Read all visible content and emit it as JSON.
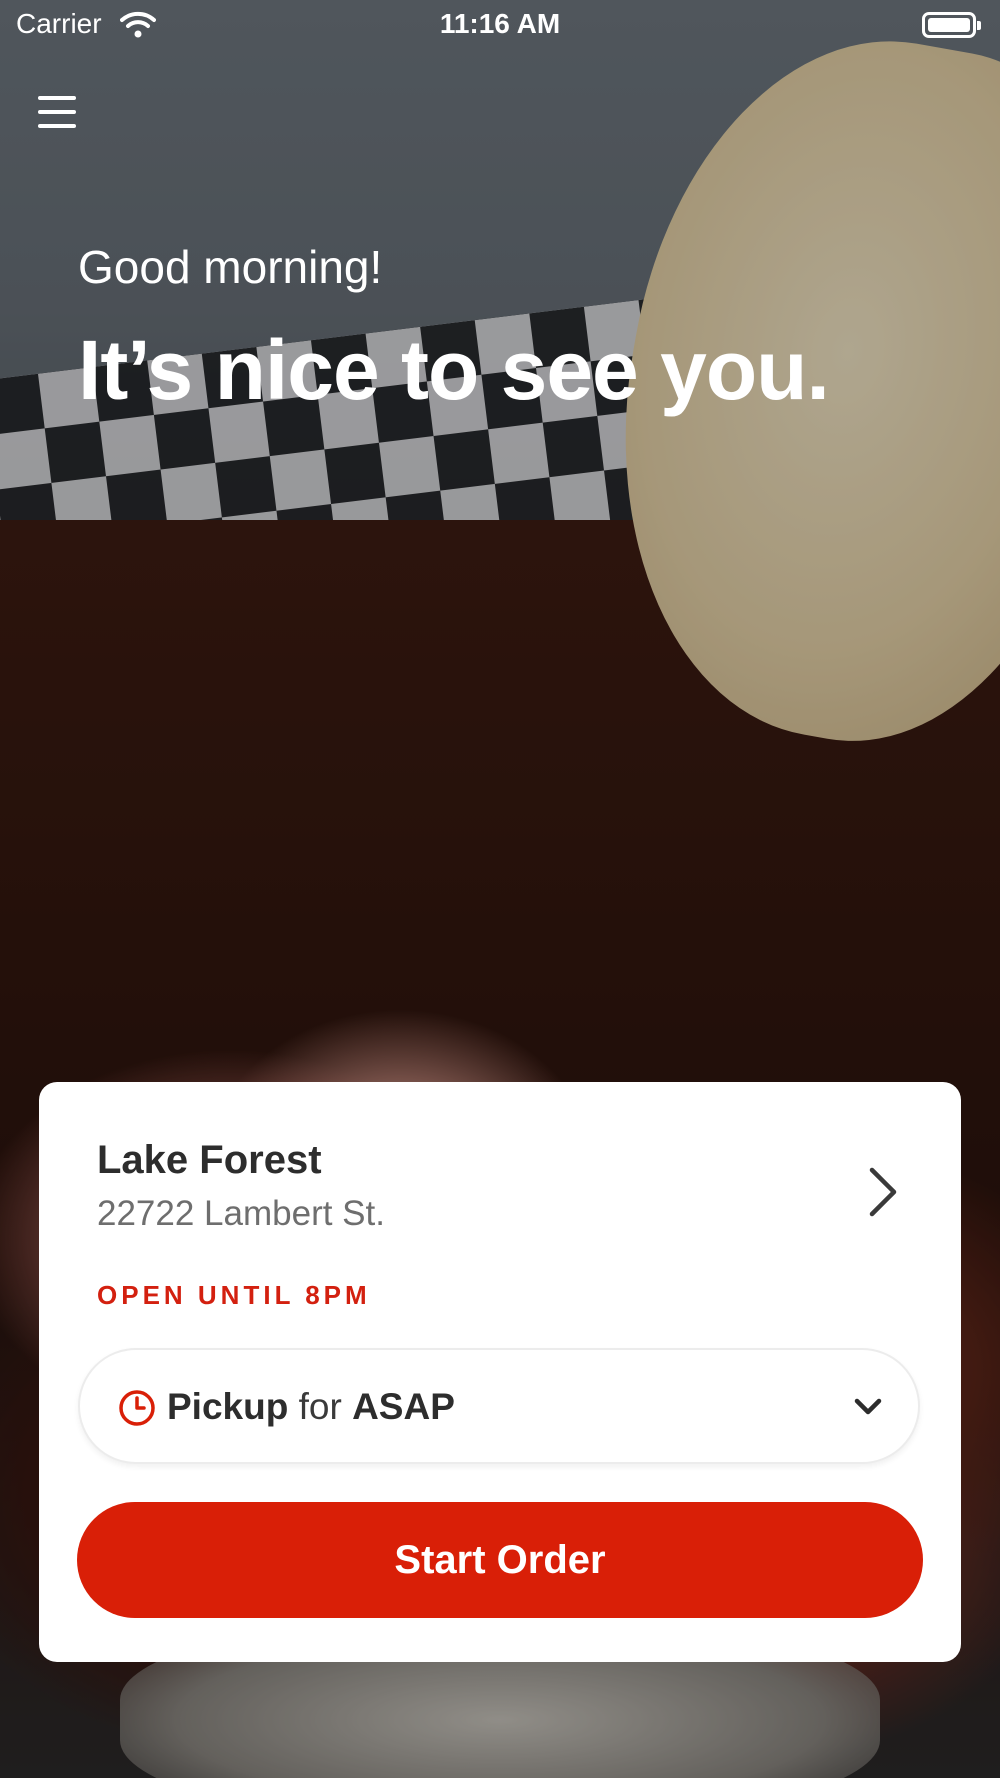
{
  "status_bar": {
    "carrier": "Carrier",
    "time": "11:16 AM"
  },
  "header": {
    "menu_icon": "hamburger-menu-icon"
  },
  "greeting": {
    "salutation": "Good morning!",
    "headline": "It’s nice to see you."
  },
  "location": {
    "name": "Lake Forest",
    "address": "22722 Lambert St.",
    "hours": "OPEN UNTIL 8PM"
  },
  "order_options": {
    "mode": "Pickup",
    "connector": "for",
    "time": "ASAP"
  },
  "actions": {
    "start_order": "Start Order"
  },
  "colors": {
    "accent": "#d91f07",
    "hours_text": "#d3200f",
    "card": "#ffffff"
  }
}
